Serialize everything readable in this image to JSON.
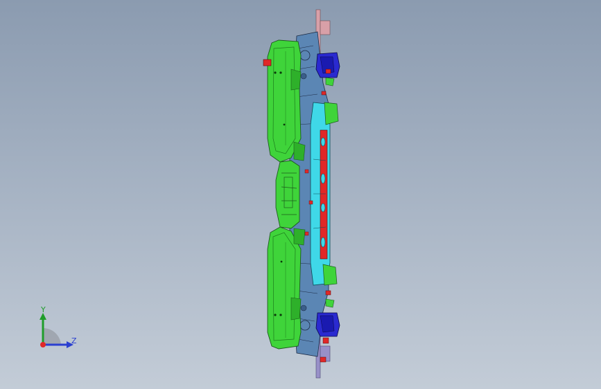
{
  "viewport": {
    "background_top": "#8b9bb0",
    "background_bottom": "#c3ccd7"
  },
  "model": {
    "colors": {
      "green_panel": "#3fd43a",
      "green_dark": "#1c7a1c",
      "cyan_rail": "#3fd8e8",
      "steel_blue": "#5b86b4",
      "navy_bracket": "#2a2ad0",
      "red_fastener": "#e02828",
      "pink_flange": "#d8a0a8",
      "lavender_flange": "#9890c8"
    }
  },
  "triad": {
    "y_label": "Y",
    "z_label": "Z",
    "y_color": "#1f9d2a",
    "z_color": "#2a3fd0",
    "origin_color": "#e02828"
  }
}
